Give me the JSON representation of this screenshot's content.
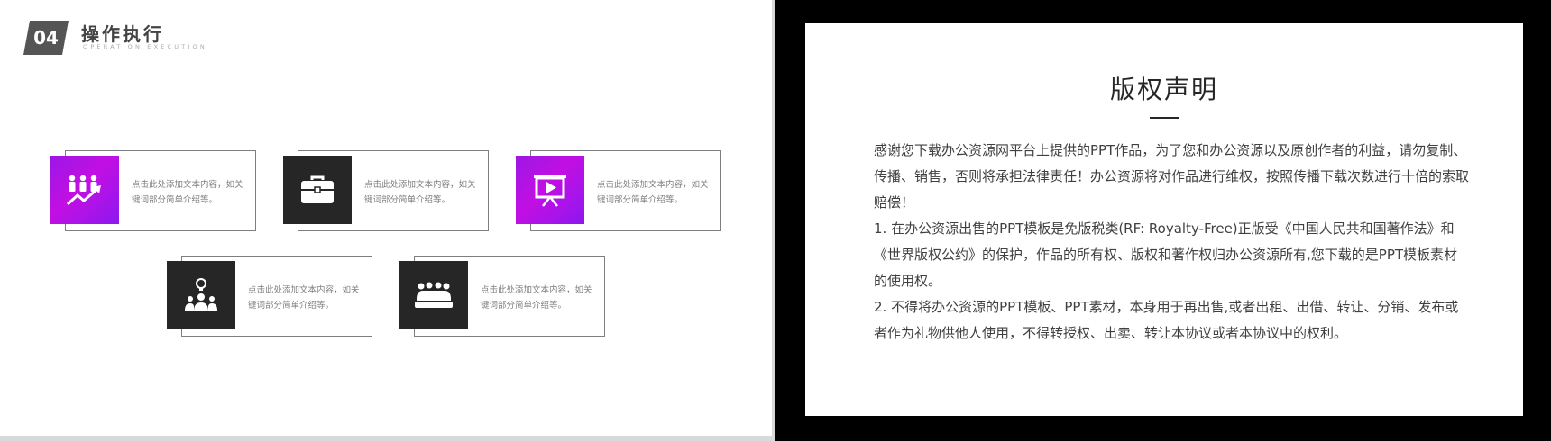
{
  "section": {
    "number": "04",
    "title": "操作执行",
    "subtitle": "OPERATION EXECUTION"
  },
  "cards": [
    {
      "icon": "people-growth-icon",
      "style": "purple",
      "text": "点击此处添加文本内容，如关键词部分简单介绍等。"
    },
    {
      "icon": "briefcase-icon",
      "style": "dark",
      "text": "点击此处添加文本内容，如关键词部分简单介绍等。"
    },
    {
      "icon": "presentation-play-icon",
      "style": "purple",
      "text": "点击此处添加文本内容，如关键词部分简单介绍等。"
    },
    {
      "icon": "idea-person-icon",
      "style": "dark",
      "text": "点击此处添加文本内容，如关键词部分简单介绍等。"
    },
    {
      "icon": "team-group-icon",
      "style": "dark",
      "text": "点击此处添加文本内容，如关键词部分简单介绍等。"
    }
  ],
  "copyright": {
    "title": "版权声明",
    "paragraphs": [
      "感谢您下载办公资源网平台上提供的PPT作品，为了您和办公资源以及原创作者的利益，请勿复制、传播、销售，否则将承担法律责任！办公资源将对作品进行维权，按照传播下载次数进行十倍的索取赔偿！",
      "  1. 在办公资源出售的PPT模板是免版税类(RF: Royalty-Free)正版受《中国人民共和国著作法》和《世界版权公约》的保护，作品的所有权、版权和著作权归办公资源所有,您下载的是PPT模板素材的使用权。",
      "  2. 不得将办公资源的PPT模板、PPT素材，本身用于再出售,或者出租、出借、转让、分销、发布或者作为礼物供他人使用，不得转授权、出卖、转让本协议或者本协议中的权利。"
    ]
  },
  "colors": {
    "accent_purple": "#a414e6",
    "dark": "#262626",
    "frame": "#7f7f7f"
  }
}
